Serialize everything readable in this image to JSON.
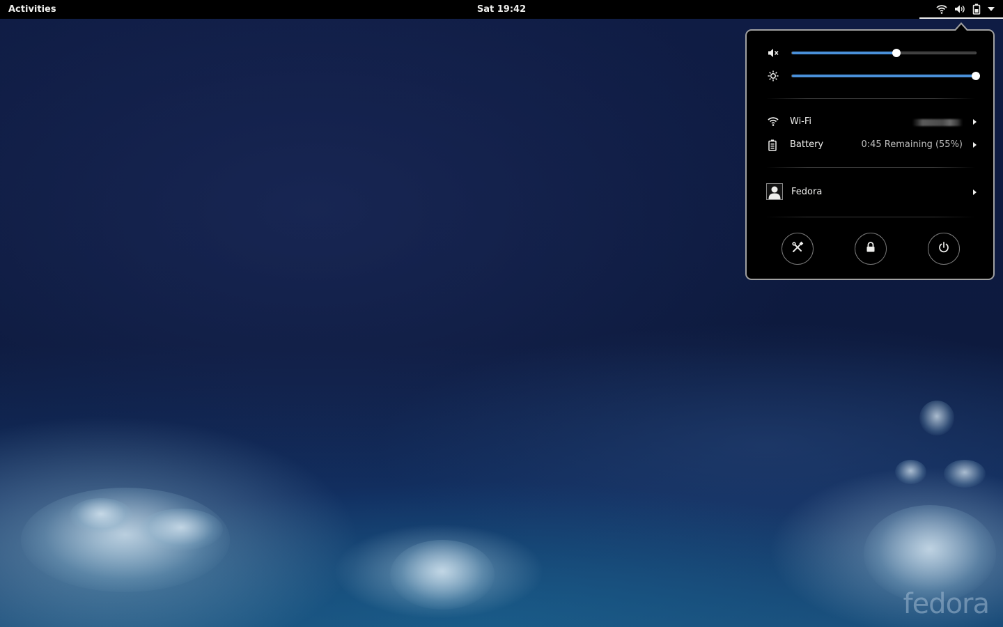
{
  "top_bar": {
    "activities_label": "Activities",
    "clock": "Sat 19:42",
    "status_icons": [
      "wifi-icon",
      "volume-icon",
      "battery-icon",
      "dropdown-arrow-icon"
    ]
  },
  "system_menu": {
    "volume": {
      "icon": "volume-muted-icon",
      "level": 0.57
    },
    "brightness": {
      "icon": "brightness-icon",
      "level": 1.0
    },
    "wifi": {
      "label": "Wi-Fi",
      "icon": "wifi-icon"
    },
    "battery": {
      "label": "Battery",
      "status": "0:45 Remaining (55%)",
      "icon": "battery-icon"
    },
    "user": {
      "label": "Fedora",
      "icon": "avatar"
    },
    "actions": [
      {
        "name": "settings-button",
        "icon": "settings-tools-icon"
      },
      {
        "name": "lock-button",
        "icon": "lock-icon"
      },
      {
        "name": "power-button",
        "icon": "power-icon"
      }
    ]
  },
  "wallpaper": {
    "logo_text": "fedora"
  },
  "colors": {
    "accent": "#4a90d9",
    "panel_bg": "#000000",
    "text": "#eeeeec"
  }
}
